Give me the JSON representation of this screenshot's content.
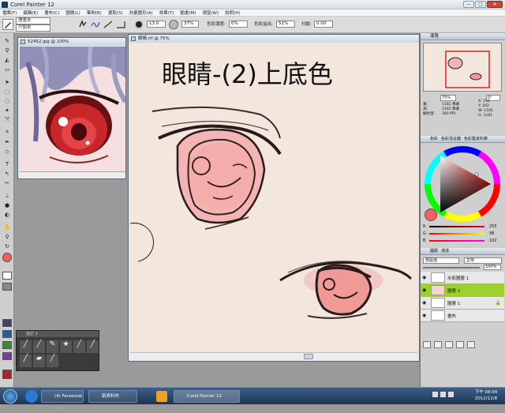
{
  "window": {
    "title": "Corel Painter 12",
    "controls": [
      "—",
      "□",
      "✕"
    ]
  },
  "menu": [
    "檔案(F)",
    "編輯(E)",
    "畫布(C)",
    "圖層(L)",
    "筆刷(B)",
    "選取(S)",
    "向量圖形(A)",
    "效果(T)",
    "動畫(M)",
    "視窗(W)",
    "說明(H)"
  ],
  "propbar": {
    "brush_category": "溼墨水",
    "brush_variant": "只加水",
    "size_value": "13.0",
    "opacity_value": "37%",
    "resat_label": "色彩濃度:",
    "resat_value": "0%",
    "bleed_label": "色彩溢出:",
    "bleed_value": "51%",
    "jitter_label": "抖動:",
    "jitter_value": "0.00"
  },
  "navigator_window": {
    "title": "52452.jpg @ 100%"
  },
  "canvas_window": {
    "title": "眼睛.rif @ 75%",
    "heading": "眼睛-(2)上底色"
  },
  "library": {
    "title": "自訂 1"
  },
  "navigator_panel": {
    "title": "導覽",
    "zoom": "75%",
    "rotation": "0°",
    "info_left": [
      "寬:",
      "高:",
      "解析度:"
    ],
    "info_vals": [
      "1181 像素",
      "1181 像素",
      "300 PPI"
    ],
    "info_right": [
      "X: 156",
      "Y: 202",
      "W: 1181",
      "H: 1181"
    ]
  },
  "color_panel": {
    "tabs": [
      "色彩",
      "色彩混合器",
      "色彩集資料庫"
    ],
    "r_label": "R",
    "g_label": "G",
    "b_label": "B",
    "r_value": "255",
    "g_value": "98",
    "b_value": "102",
    "current_color": "#f2615e"
  },
  "layers_panel": {
    "tabs": [
      "圖層",
      "通道"
    ],
    "composite_method": "預設值",
    "composite_mode": "正常",
    "opacity": "100%",
    "layers": [
      {
        "name": "水彩圖層 1",
        "selected": false
      },
      {
        "name": "圖層 2",
        "selected": true
      },
      {
        "name": "圖層 1",
        "selected": false
      },
      {
        "name": "畫布",
        "selected": false
      }
    ]
  },
  "taskbar": {
    "items": [
      "(4) Facebook -...",
      "新資料夾",
      "Corel Painter 12"
    ],
    "time": "下午 08:04",
    "date": "2012/12/8"
  }
}
